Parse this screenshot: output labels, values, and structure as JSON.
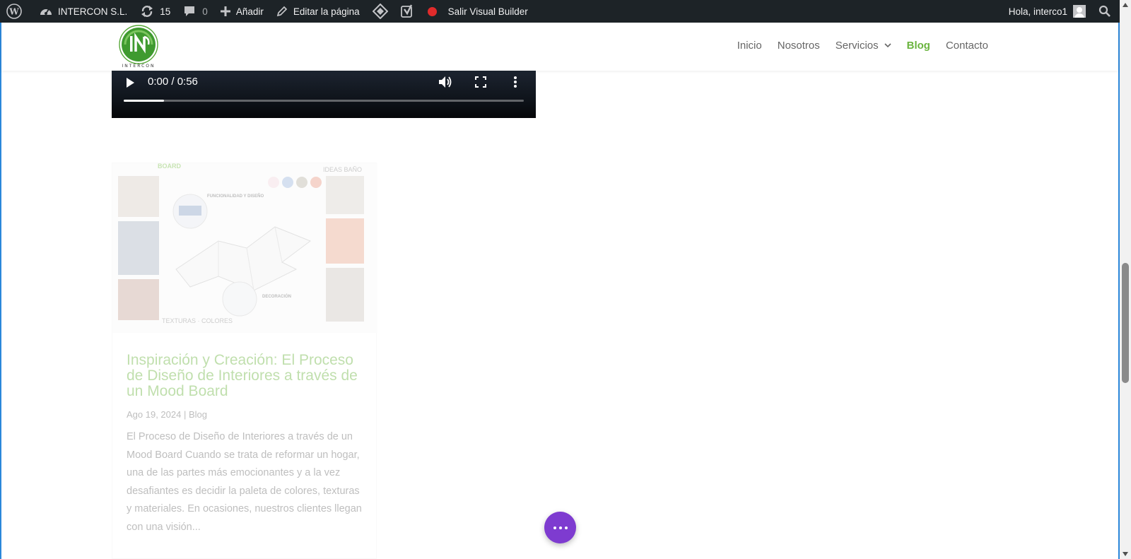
{
  "adminbar": {
    "site_name": "INTERCON S.L.",
    "updates_count": "15",
    "comments_count": "0",
    "add_new": "Añadir",
    "edit_page": "Editar la página",
    "exit_builder": "Salir Visual Builder",
    "greeting": "Hola, interco1"
  },
  "header": {
    "logo_text": "INTERCON",
    "nav": [
      {
        "label": "Inicio"
      },
      {
        "label": "Nosotros"
      },
      {
        "label": "Servicios"
      },
      {
        "label": "Blog",
        "active": true
      },
      {
        "label": "Contacto"
      }
    ]
  },
  "video": {
    "time": "0:00 / 0:56",
    "progress_fraction": 0.1
  },
  "post": {
    "image_labels": {
      "brand": "BOARD",
      "ideas": "IDEAS BAÑO",
      "functionality": "FUNCIONALIDAD Y DISEÑO",
      "decoration": "DECORACIÓN",
      "textures": "TEXTURAS · COLORES"
    },
    "title": "Inspiración y Creación: El Proceso de Diseño de Interiores a través de un Mood Board",
    "date": "Ago 19, 2024",
    "separator": "|",
    "category": "Blog",
    "excerpt": "El Proceso de Diseño de Interiores a través de un Mood Board Cuando se trata de reformar un hogar, una de las partes más emocionantes y a la vez desafiantes es decidir la paleta de colores, texturas y materiales. En ocasiones, nuestros clientes llegan con una visión..."
  },
  "colors": {
    "accent_green": "#6ab43e",
    "builder_purple": "#7e3bd0",
    "frame_blue": "#2b87da",
    "adminbar_bg": "#1d2327"
  }
}
